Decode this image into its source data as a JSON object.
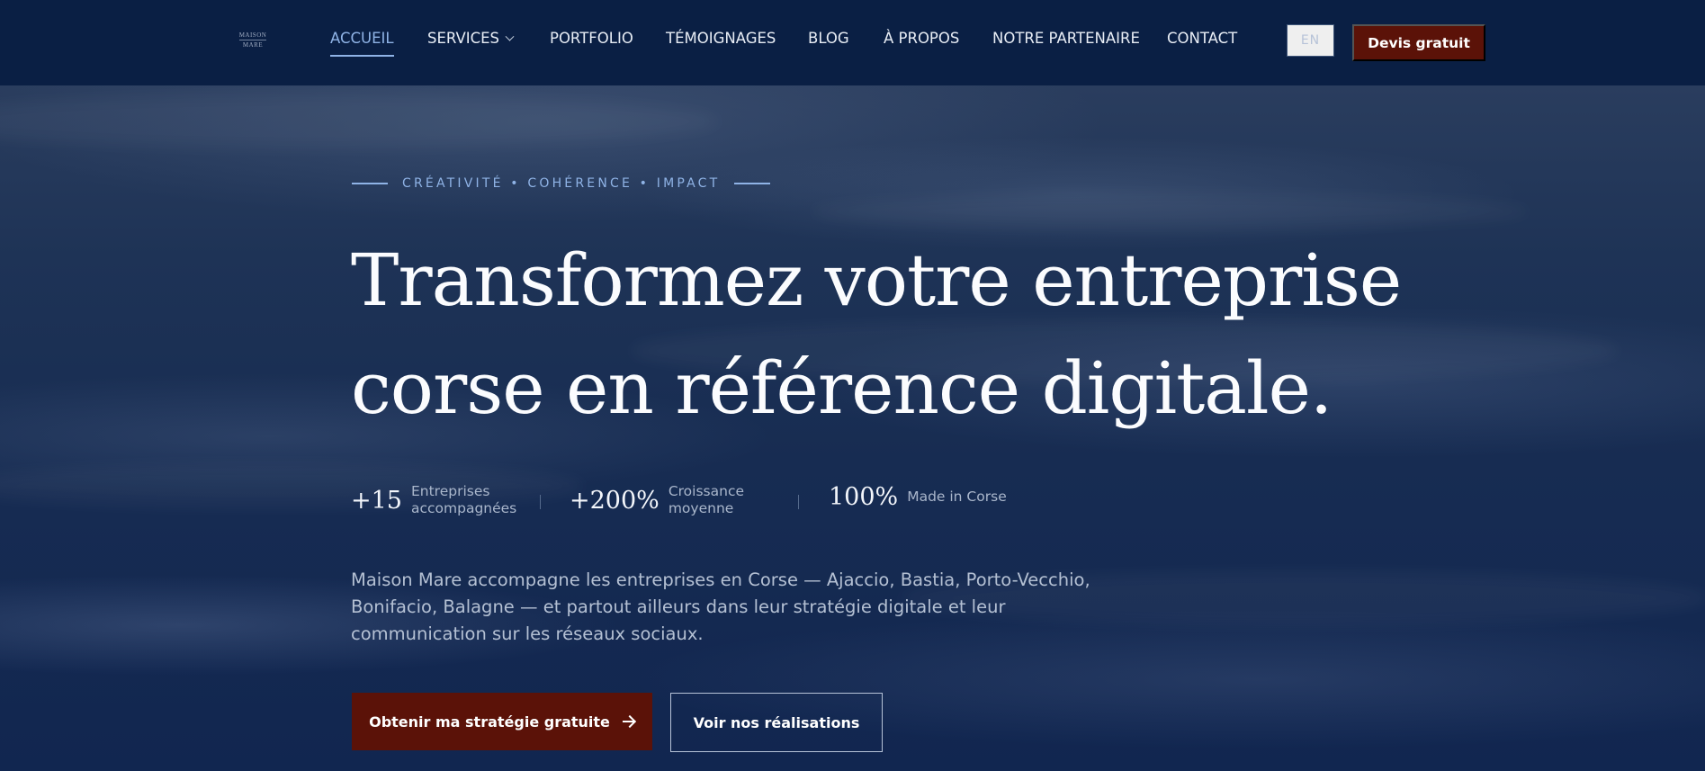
{
  "brand": {
    "logo_text_1": "MAISON",
    "logo_text_2": "MARE"
  },
  "nav": {
    "items": [
      {
        "label": "ACCUEIL",
        "active": true
      },
      {
        "label": "SERVICES",
        "has_dropdown": true
      },
      {
        "label": "PORTFOLIO"
      },
      {
        "label": "TÉMOIGNAGES"
      },
      {
        "label": "BLOG"
      },
      {
        "label": "À PROPOS"
      },
      {
        "label": "NOTRE PARTENAIRE"
      },
      {
        "label": "CONTACT"
      }
    ],
    "language": "EN",
    "quote_label": "Devis gratuit"
  },
  "hero": {
    "eyebrow": "CRÉATIVITÉ • COHÉRENCE • IMPACT",
    "headline_line1": "Transformez votre entreprise",
    "headline_line2": "corse en référence digitale.",
    "stats": [
      {
        "value": "+15",
        "label_line1": "Entreprises",
        "label_line2": "accompagnées"
      },
      {
        "value": "+200%",
        "label_line1": "Croissance",
        "label_line2": "moyenne"
      },
      {
        "value": "100%",
        "label_line1": "Made in Corse",
        "label_line2": ""
      }
    ],
    "description": "Maison Mare accompagne les entreprises en Corse — Ajaccio, Bastia, Porto-Vecchio, Bonifacio, Balagne — et partout ailleurs dans leur stratégie digitale et leur communication sur les réseaux sociaux.",
    "cta_primary": "Obtenir ma stratégie gratuite",
    "cta_secondary": "Voir nos réalisations"
  },
  "colors": {
    "header_bg": "#0a1f44",
    "accent_blue": "#8fb3e6",
    "cta_red": "#5b1208"
  }
}
